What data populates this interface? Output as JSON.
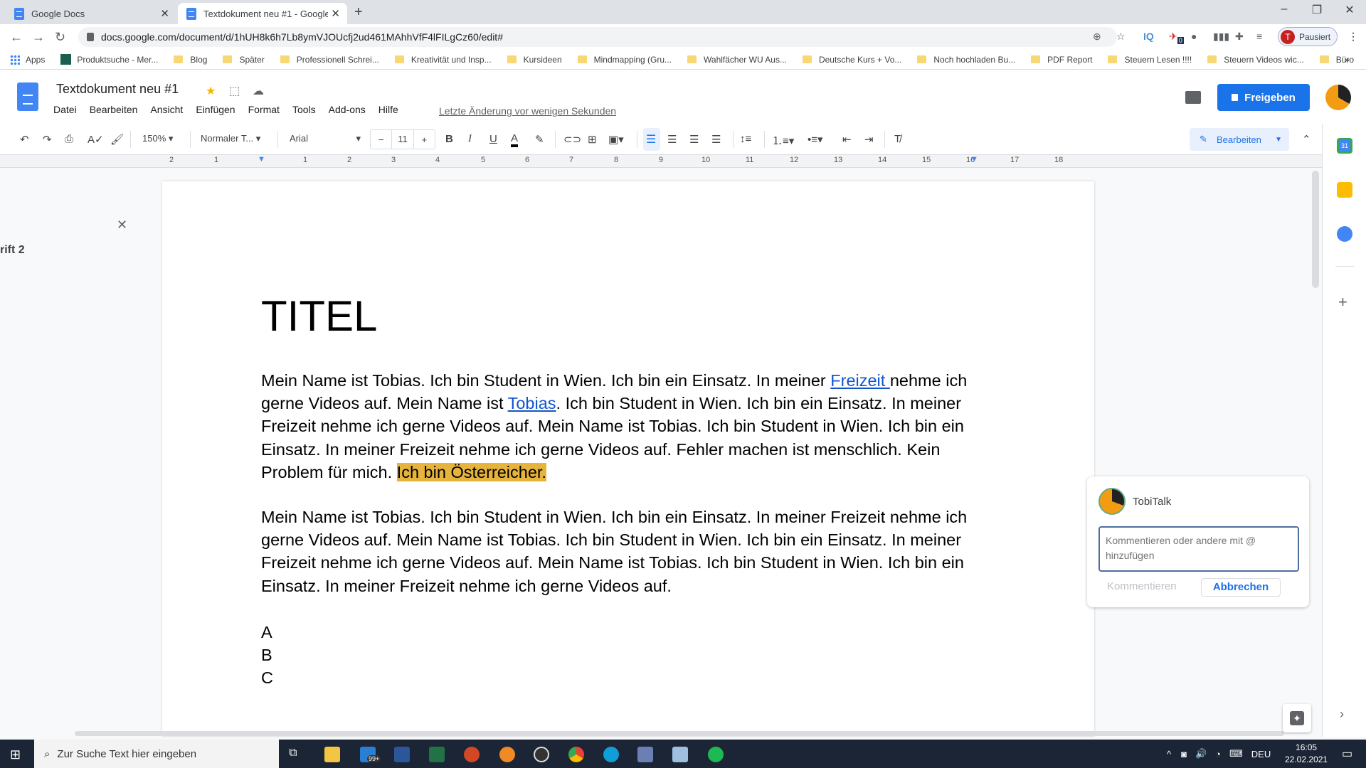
{
  "browser": {
    "tabs": [
      {
        "title": "Google Docs",
        "active": false
      },
      {
        "title": "Textdokument neu #1 - Google D",
        "active": true
      }
    ],
    "url": "docs.google.com/document/d/1hUH8k6h7Lb8ymVJOUcfj2ud461MAhhVfF4lFILgCz60/edit#",
    "profile_initial": "T",
    "profile_status": "Pausiert",
    "extension_badge": "0",
    "bookmarks": [
      "Apps",
      "Produktsuche - Mer...",
      "Blog",
      "Später",
      "Professionell Schrei...",
      "Kreativität und Insp...",
      "Kursideen",
      "Mindmapping  (Gru...",
      "Wahlfächer WU Aus...",
      "Deutsche Kurs + Vo...",
      "Noch hochladen Bu...",
      "PDF Report",
      "Steuern Lesen !!!!",
      "Steuern Videos wic...",
      "Büro"
    ],
    "bookmarks_overflow": "»"
  },
  "docs": {
    "title": "Textdokument neu #1",
    "menu": [
      "Datei",
      "Bearbeiten",
      "Ansicht",
      "Einfügen",
      "Format",
      "Tools",
      "Add-ons",
      "Hilfe"
    ],
    "last_edit": "Letzte Änderung vor wenigen Sekunden",
    "share_label": "Freigeben",
    "toolbar": {
      "zoom": "150%",
      "style": "Normaler T...",
      "font": "Arial",
      "font_size": "11",
      "mode": "Bearbeiten"
    },
    "ruler_ticks": [
      "2",
      "1",
      "1",
      "2",
      "3",
      "4",
      "5",
      "6",
      "7",
      "8",
      "9",
      "10",
      "11",
      "12",
      "13",
      "14",
      "15",
      "16",
      "17",
      "18"
    ],
    "outline": {
      "item": "rift 2"
    }
  },
  "document": {
    "heading": "TITEL",
    "para1": {
      "t1": "Mein Name ist Tobias. Ich bin Student in Wien. Ich bin ein Einsatz. In meiner ",
      "link1": "Freizeit ",
      "t2": "nehme ich gerne Videos auf. Mein Name ist ",
      "link2": "Tobias",
      "t3": ". Ich bin Student in Wien. Ich bin ein Einsatz. In meiner Freizeit nehme ich gerne Videos auf. Mein Name ist Tobias. Ich bin Student in Wien. Ich bin ein Einsatz. In meiner Freizeit nehme ich gerne Videos auf. Fehler machen ist menschlich. Kein Problem für mich. ",
      "highlight": "Ich bin Österreicher."
    },
    "para2": "Mein Name ist Tobias. Ich bin Student in Wien. Ich bin ein Einsatz. In meiner Freizeit nehme ich gerne Videos auf. Mein Name ist Tobias. Ich bin Student in Wien. Ich bin ein Einsatz. In meiner Freizeit nehme ich gerne Videos auf. Mein Name ist Tobias. Ich bin Student in Wien. Ich bin ein Einsatz. In meiner Freizeit nehme ich gerne Videos auf.",
    "list": [
      "A",
      "B",
      "C"
    ],
    "highlight_color": "#e6b43c",
    "link_color": "#1155cc"
  },
  "comment": {
    "author": "TobiTalk",
    "placeholder": "Kommentieren oder andere mit @ hinzufügen",
    "submit_label": "Kommentieren",
    "cancel_label": "Abbrechen"
  },
  "taskbar": {
    "search_placeholder": "Zur Suche Text hier eingeben",
    "mail_badge": "99+",
    "language": "DEU",
    "time": "16:05",
    "date": "22.02.2021"
  },
  "colors": {
    "accent": "#1a73e8",
    "taskbar": "#1c2535"
  }
}
